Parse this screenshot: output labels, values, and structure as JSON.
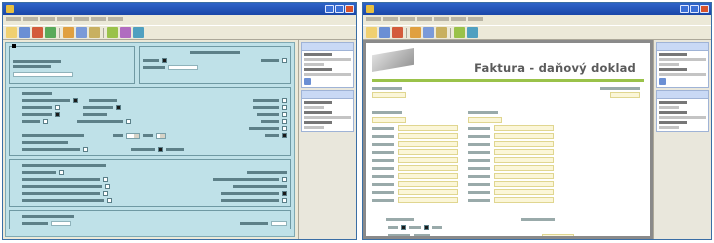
{
  "right_window": {
    "document": {
      "title": "Faktura - daňový doklad"
    }
  },
  "colors": {
    "titlebar": "#1f52b8",
    "form_background": "#bfe1e8",
    "invoice_accent": "#9ac24a",
    "field_highlight": "#fbf6d8"
  }
}
